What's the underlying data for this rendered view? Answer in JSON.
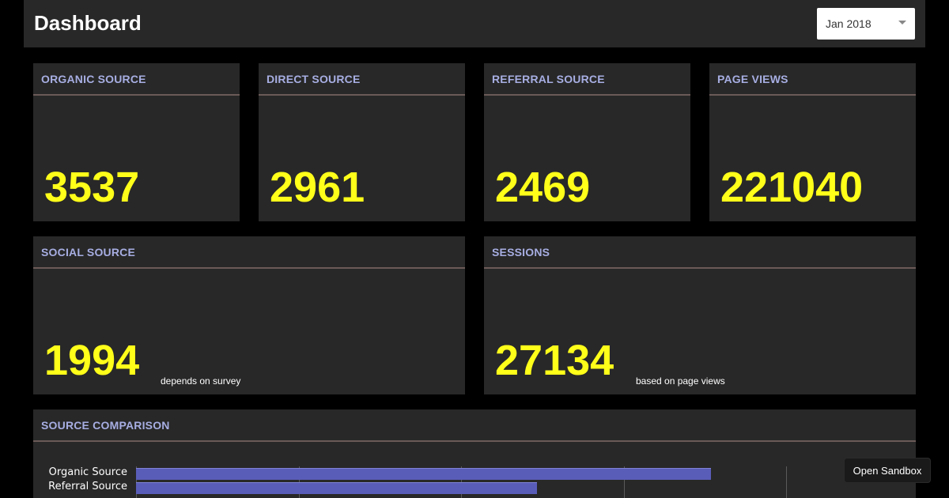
{
  "header": {
    "title": "Dashboard",
    "month_select": {
      "value": "Jan 2018"
    }
  },
  "cards": {
    "organic": {
      "title": "ORGANIC SOURCE",
      "value": "3537"
    },
    "direct": {
      "title": "DIRECT SOURCE",
      "value": "2961"
    },
    "referral": {
      "title": "REFERRAL SOURCE",
      "value": "2469"
    },
    "page_views": {
      "title": "PAGE VIEWS",
      "value": "221040"
    },
    "social": {
      "title": "SOCIAL SOURCE",
      "value": "1994",
      "note": "depends on survey"
    },
    "sessions": {
      "title": "SESSIONS",
      "value": "27134",
      "note": "based on page views"
    }
  },
  "comparison": {
    "title": "SOURCE COMPARISON"
  },
  "chart_data": {
    "type": "bar",
    "orientation": "horizontal",
    "categories": [
      "Organic Source",
      "Referral Source"
    ],
    "values": [
      3537,
      2469
    ],
    "xlim": [
      0,
      4000
    ],
    "grid": true,
    "bar_color": "#5a5db8"
  },
  "sandbox_button": {
    "label": "Open Sandbox"
  },
  "colors": {
    "kpi_value": "#ffff1a",
    "card_title": "#a7aee2",
    "card_background": "#282828",
    "page_background": "#000000"
  }
}
